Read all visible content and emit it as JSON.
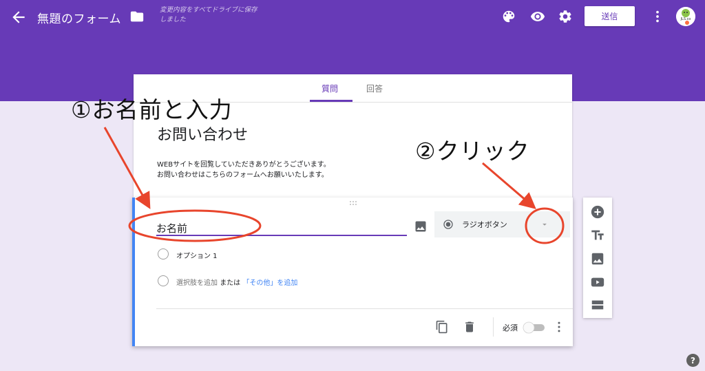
{
  "topbar": {
    "title": "無題のフォーム",
    "save_status": "変更内容をすべてドライブに保存しました",
    "send_label": "送信",
    "avatar_text": "JLS.co",
    "background_color": "#673ab7"
  },
  "tabs": [
    {
      "label": "質問",
      "active": true
    },
    {
      "label": "回答",
      "active": false
    }
  ],
  "form": {
    "title": "お問い合わせ",
    "description_line1": "WEBサイトを回覧していただきありがとうございます。",
    "description_line2": "お問い合わせはこちらのフォームへお願いいたします。"
  },
  "question": {
    "title": "お名前",
    "type_label": "ラジオボタン",
    "options": [
      {
        "label": "オプション 1"
      }
    ],
    "add_option": {
      "add_label": "選択肢を追加",
      "or_label": "または",
      "add_other_label": "「その他」を追加"
    },
    "required_label": "必須",
    "required": false
  },
  "side_toolbar": {
    "items": [
      "add-question-icon",
      "title-text-icon",
      "image-icon",
      "video-icon",
      "section-icon"
    ]
  },
  "help_label": "?",
  "annotations": {
    "step1": "①お名前と入力",
    "step2": "②クリック",
    "color": "#e8452c"
  }
}
